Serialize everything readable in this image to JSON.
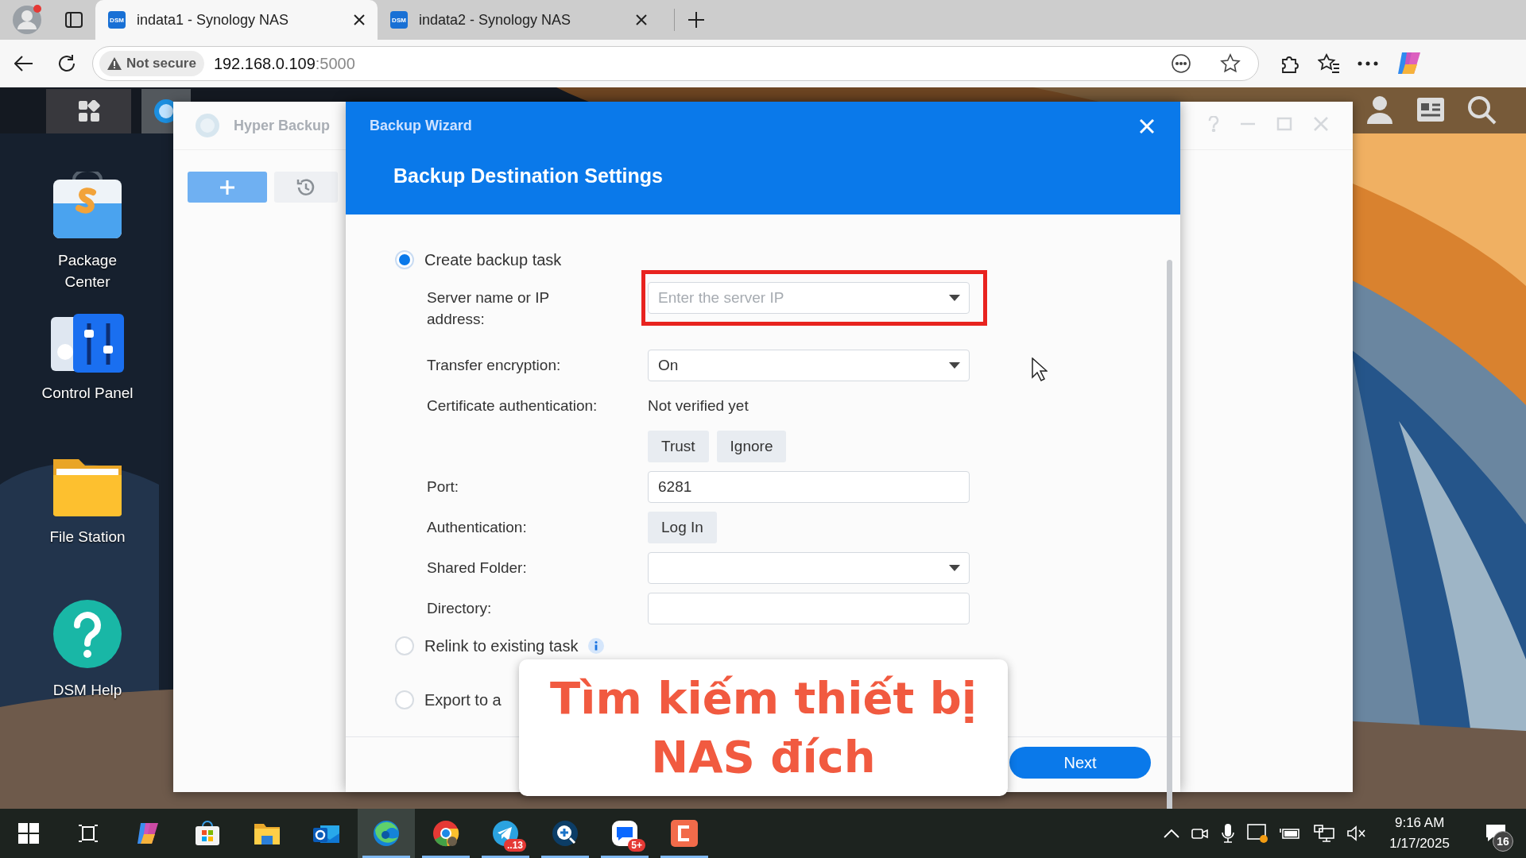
{
  "browser": {
    "tabs": [
      {
        "favicon": "DSM",
        "title": "indata1 - Synology NAS",
        "selected": true
      },
      {
        "favicon": "DSM",
        "title": "indata2 - Synology NAS",
        "selected": false
      }
    ],
    "address": {
      "security": "Not secure",
      "host": "192.168.0.109",
      "port": ":5000"
    }
  },
  "desktop": {
    "icons": [
      {
        "kind": "package",
        "label": "Package Center"
      },
      {
        "kind": "control",
        "label": "Control Panel"
      },
      {
        "kind": "folder",
        "label": "File Station"
      },
      {
        "kind": "help",
        "label": "DSM Help"
      }
    ]
  },
  "hyper_backup": {
    "title": "Hyper Backup"
  },
  "wizard": {
    "title": "Backup Wizard",
    "heading": "Backup Destination Settings",
    "options": [
      {
        "label": "Create backup task",
        "selected": true
      },
      {
        "label": "Relink to existing task",
        "selected": false,
        "info": true
      },
      {
        "label": "Export to a",
        "selected": false
      }
    ],
    "fields": [
      {
        "kind": "dropdown",
        "label": "Server name or IP address:",
        "placeholder": "Enter the server IP",
        "highlighted": true
      },
      {
        "kind": "dropdown",
        "label": "Transfer encryption:",
        "value": "On"
      },
      {
        "kind": "text",
        "label": "Certificate authentication:",
        "value": "Not verified yet"
      },
      {
        "kind": "buttons",
        "buttons": [
          "Trust",
          "Ignore"
        ]
      },
      {
        "kind": "input",
        "label": "Port:",
        "value": "6281"
      },
      {
        "kind": "buttons",
        "label": "Authentication:",
        "buttons": [
          "Log In"
        ]
      },
      {
        "kind": "dropdown",
        "label": "Shared Folder:"
      },
      {
        "kind": "input",
        "label": "Directory:"
      }
    ],
    "next": "Next"
  },
  "caption": "Tìm kiếm thiết bị NAS đích",
  "taskbar": {
    "apps": [
      {
        "kind": "start",
        "selected": false,
        "running": false
      },
      {
        "kind": "taskview",
        "selected": false,
        "running": false
      },
      {
        "kind": "copilot",
        "selected": false,
        "running": false
      },
      {
        "kind": "store",
        "selected": false,
        "running": false
      },
      {
        "kind": "explorer",
        "selected": false,
        "running": false
      },
      {
        "kind": "outlook",
        "selected": false,
        "running": false
      },
      {
        "kind": "edge",
        "selected": true,
        "running": true
      },
      {
        "kind": "chrome",
        "selected": false,
        "running": true
      },
      {
        "kind": "telegram",
        "selected": false,
        "running": true,
        "badge": "..13"
      },
      {
        "kind": "lens",
        "selected": false,
        "running": true
      },
      {
        "kind": "zalo",
        "selected": false,
        "running": true,
        "badge": "5+"
      },
      {
        "kind": "clipchamp",
        "selected": false,
        "running": true
      }
    ],
    "time": "9:16 AM",
    "date": "1/17/2025",
    "notifications": "16"
  }
}
